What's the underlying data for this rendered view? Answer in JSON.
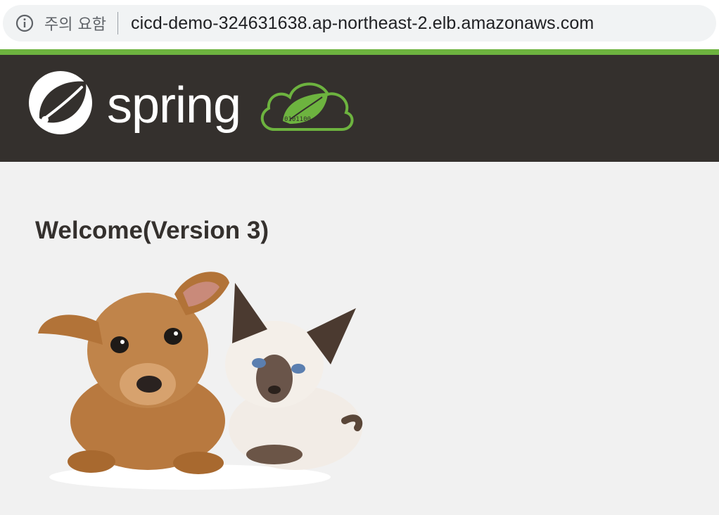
{
  "browser": {
    "security_label": "주의 요함",
    "url": "cicd-demo-324631638.ap-northeast-2.elb.amazonaws.com",
    "security_icon": "info-icon"
  },
  "header": {
    "logo_text": "spring",
    "cloud_binary": "0101100",
    "colors": {
      "header_bg": "#34302d",
      "accent": "#6db33f"
    }
  },
  "main": {
    "title": "Welcome(Version 3)",
    "image_subject": "pets-image"
  }
}
